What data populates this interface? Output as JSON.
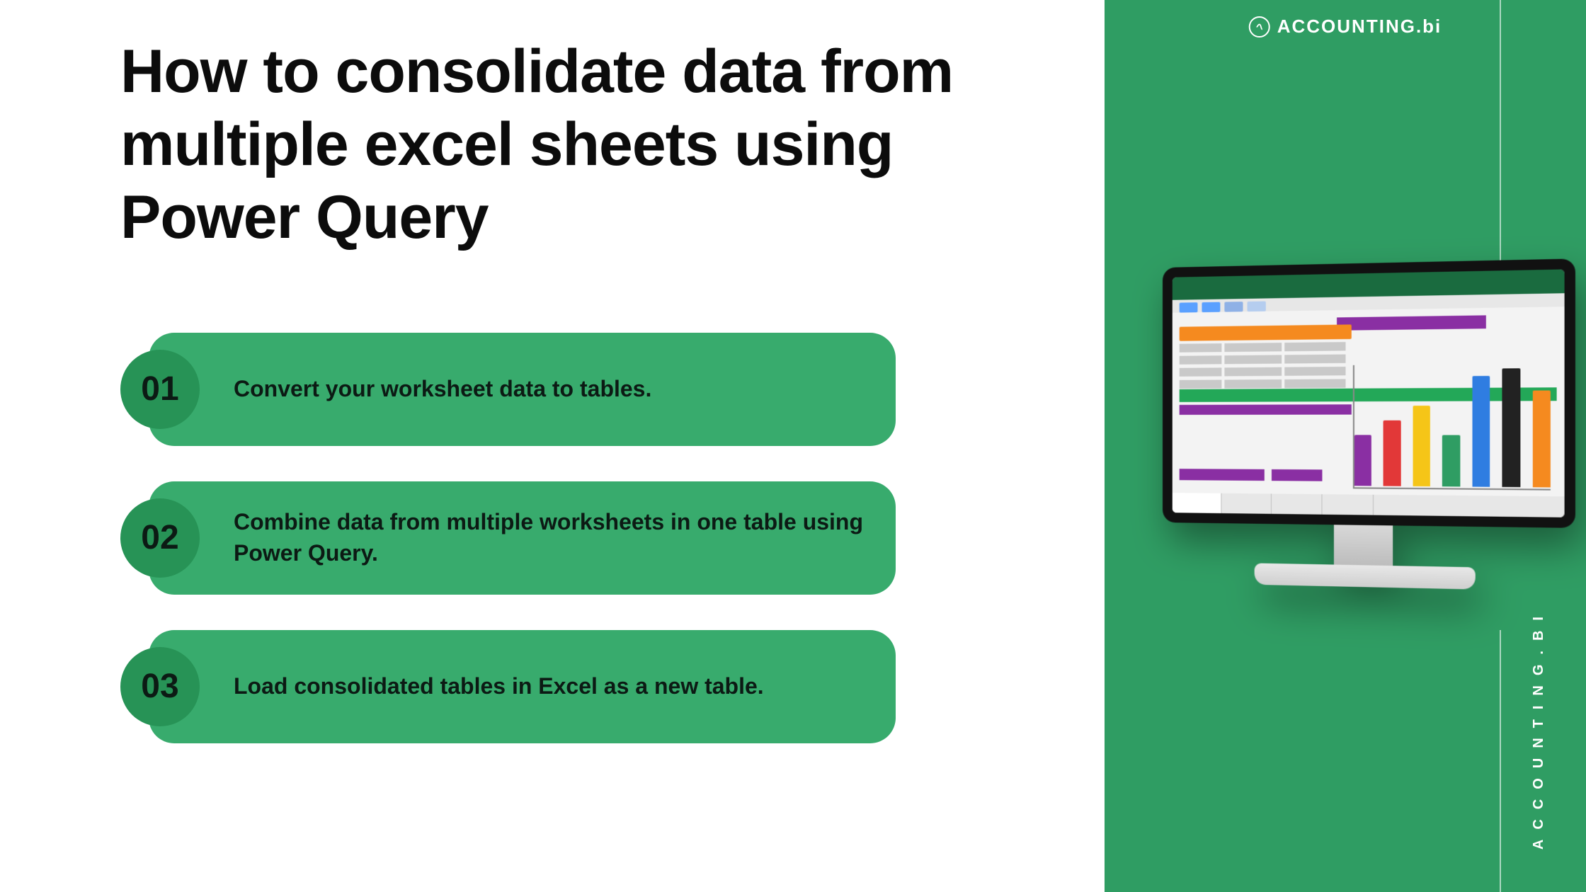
{
  "title": "How to consolidate data from multiple excel sheets using Power Query",
  "steps": [
    {
      "num": "01",
      "text": "Convert your worksheet data to tables."
    },
    {
      "num": "02",
      "text": "Combine data from multiple worksheets in one table using Power Query."
    },
    {
      "num": "03",
      "text": "Load consolidated tables in Excel as a new table."
    }
  ],
  "brand": "ACCOUNTING.bi",
  "side_label": "ACCOUNTING.BI",
  "colors": {
    "pill": "#38ab6d",
    "badge": "#279356",
    "sidebar": "#2f9d63"
  }
}
